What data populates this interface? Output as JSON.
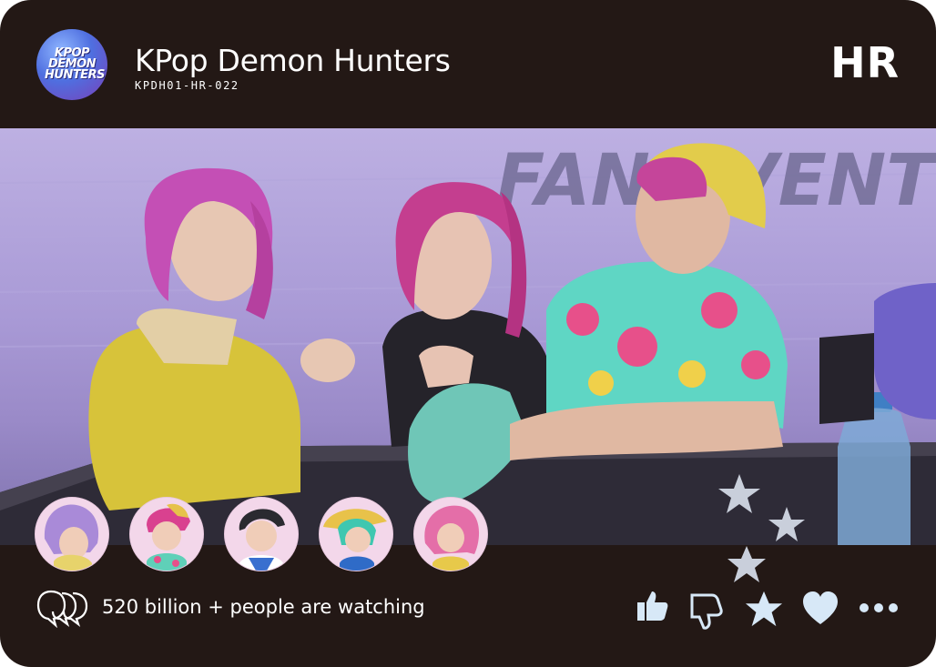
{
  "header": {
    "logo_text": "KPOP DEMON HUNTERS",
    "title": "KPop Demon Hunters",
    "code": "KPDH01-HR-022",
    "rarity": "HR"
  },
  "scene": {
    "background_sign": "FAN EVENT"
  },
  "avatars": [
    {
      "name": "purple-hair-member"
    },
    {
      "name": "pink-hair-member"
    },
    {
      "name": "dark-hair-member"
    },
    {
      "name": "teal-hair-member"
    },
    {
      "name": "pink-long-hair-member"
    }
  ],
  "footer": {
    "viewers_text": "520 billion + people are watching",
    "actions": [
      "like-icon",
      "dislike-icon",
      "favorite-star-icon",
      "heart-icon",
      "more-icon"
    ]
  },
  "colors": {
    "card_bg": "#231815",
    "icon_fill": "#d7e8f7",
    "star": "#c9cfdb"
  }
}
